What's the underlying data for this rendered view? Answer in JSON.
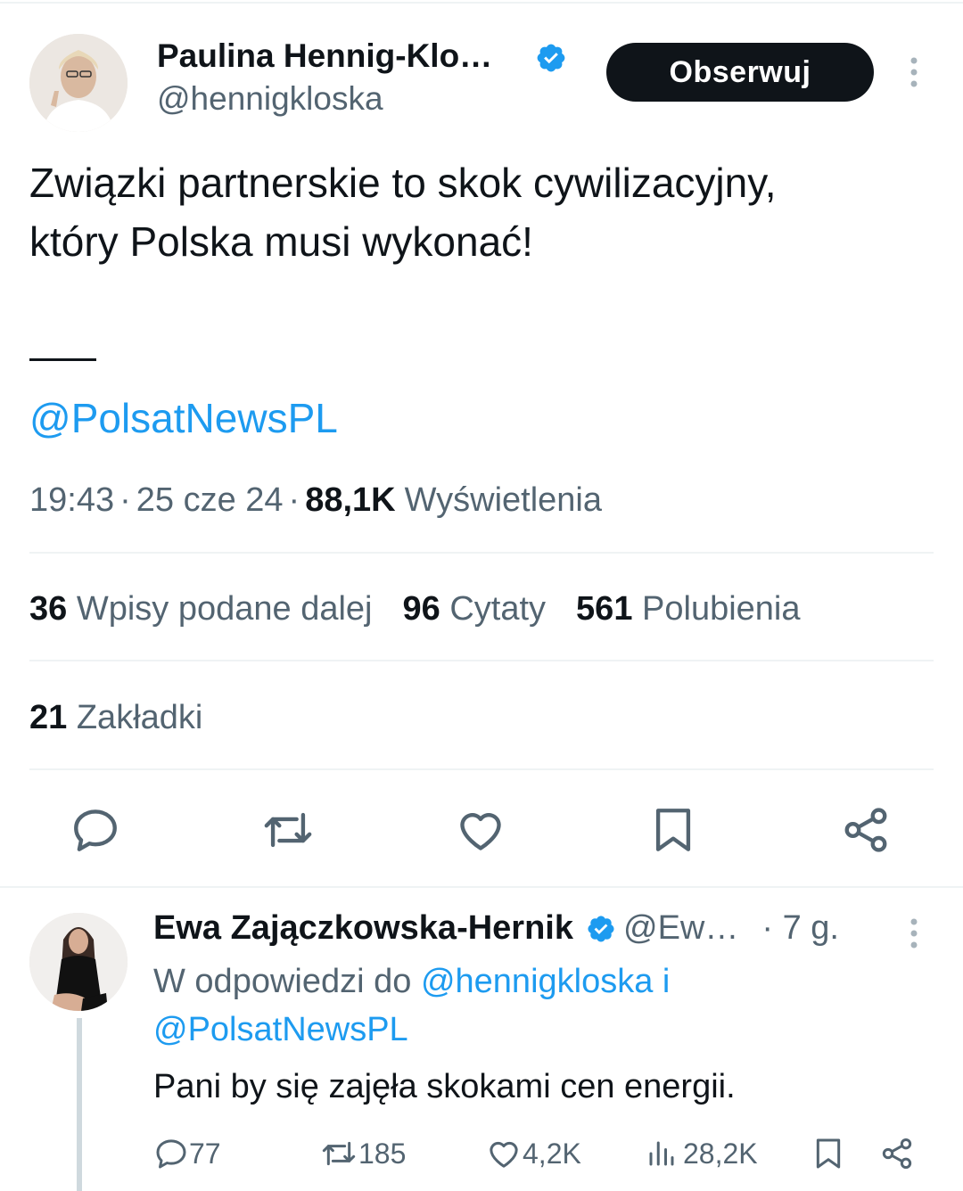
{
  "tweet": {
    "author_name": "Paulina Hennig-Klo…",
    "handle": "@hennigkloska",
    "follow_label": "Obserwuj",
    "text_line1": "Związki partnerskie to skok cywilizacyjny,",
    "text_line2": "który Polska musi wykonać!",
    "separator": "—",
    "mention": "@PolsatNewsPL",
    "time": "19:43",
    "date": "25 cze 24",
    "views_count": "88,1K",
    "views_label": "Wyświetlenia",
    "dot": "·",
    "retweets_count": "36",
    "retweets_label": "Wpisy podane dalej",
    "quotes_count": "96",
    "quotes_label": "Cytaty",
    "likes_count": "561",
    "likes_label": "Polubienia",
    "bookmarks_count": "21",
    "bookmarks_label": "Zakładki"
  },
  "actions": [
    "reply-icon",
    "retweet-icon",
    "like-icon",
    "bookmark-icon",
    "share-icon"
  ],
  "reply": {
    "author_name": "Ewa Zajączkowska-Hernik",
    "handle": "@Ew…",
    "time": "· 7 g.",
    "in_reply_prefix": "W odpowiedzi do",
    "reply_to_1": "@hennigkloska",
    "conjunction": "i",
    "reply_to_2": "@PolsatNewsPL",
    "text": "Pani by się zajęła skokami cen energii.",
    "replies": "77",
    "retweets": "185",
    "likes": "4,2K",
    "views": "28,2K"
  },
  "colors": {
    "accent": "#1d9bf0",
    "text": "#0f1419",
    "muted": "#536471",
    "verified": "#1d9bf0",
    "button_bg": "#0f1419"
  }
}
